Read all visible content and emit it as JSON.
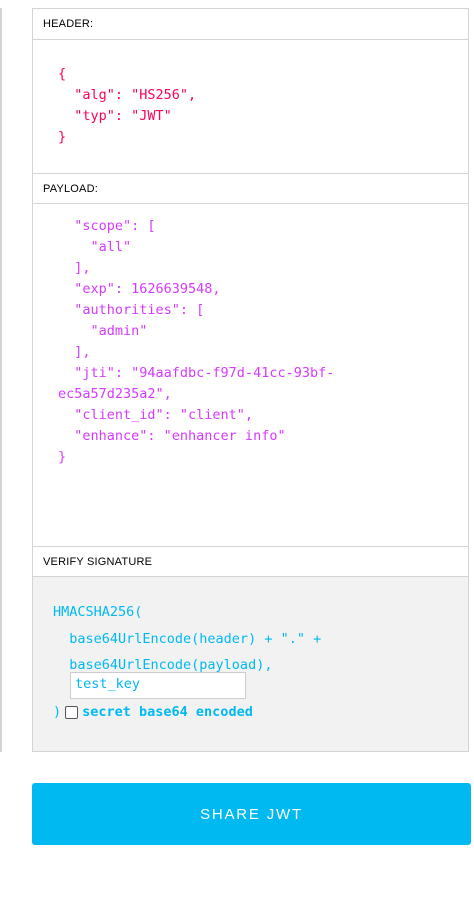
{
  "header": {
    "title": "HEADER:",
    "code": "{\n  \"alg\": \"HS256\",\n  \"typ\": \"JWT\"\n}"
  },
  "payload": {
    "title": "PAYLOAD:",
    "code": "  \"scope\": [\n    \"all\"\n  ],\n  \"exp\": 1626639548,\n  \"authorities\": [\n    \"admin\"\n  ],\n  \"jti\": \"94aafdbc-f97d-41cc-93bf-\nec5a57d235a2\",\n  \"client_id\": \"client\",\n  \"enhance\": \"enhancer info\"\n}"
  },
  "verify": {
    "title": "VERIFY SIGNATURE",
    "code": "HMACSHA256(\n  base64UrlEncode(header) + \".\" +\n  base64UrlEncode(payload),",
    "secret_value": "test_key",
    "closing": ")",
    "checkbox_label": "secret base64 encoded"
  },
  "share": {
    "label": "SHARE JWT"
  },
  "colors": {
    "header_code": "#fb015b",
    "payload_code": "#d63aff",
    "signature_code": "#00b9f1",
    "button_bg": "#00b9f1"
  }
}
